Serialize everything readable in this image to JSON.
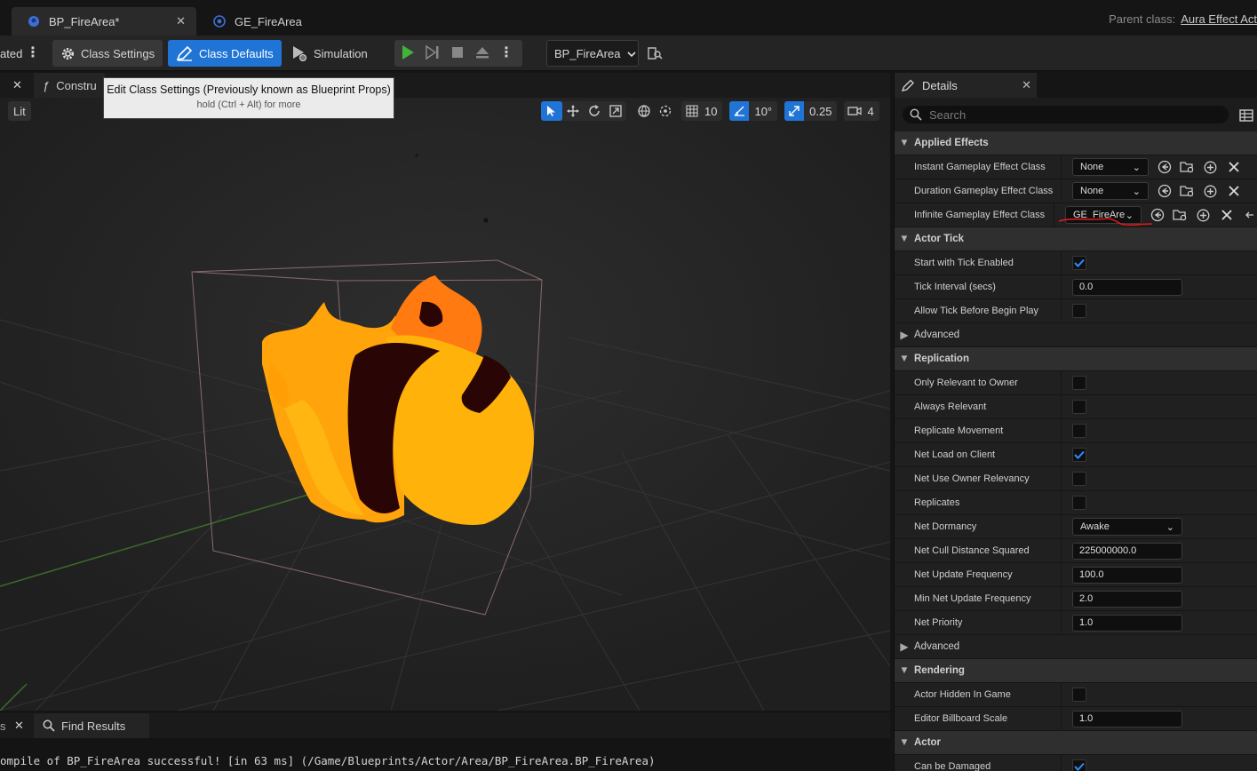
{
  "tabs": [
    {
      "label": "BP_FireArea*"
    },
    {
      "label": "GE_FireArea"
    }
  ],
  "parent_class": {
    "prefix": "Parent class:",
    "value": "Aura Effect Act"
  },
  "toolbar": {
    "left_cut_label": "ated",
    "class_settings": "Class Settings",
    "class_defaults": "Class Defaults",
    "simulation": "Simulation",
    "debug_object": "BP_FireArea"
  },
  "tooltip": {
    "title": "Edit Class Settings (Previously known as Blueprint Props)",
    "hint": "hold (Ctrl + Alt) for more"
  },
  "viewport": {
    "construction_tab": "Constru",
    "view_mode": "Lit",
    "grid_snap": "10",
    "rotation_snap": "10°",
    "scale_snap": "0.25",
    "camera_speed": "4"
  },
  "bottom": {
    "find_results": "Find Results",
    "log_line": "ompile of BP_FireArea successful! [in 63 ms] (/Game/Blueprints/Actor/Area/BP_FireArea.BP_FireArea)"
  },
  "details": {
    "title": "Details",
    "search_placeholder": "Search",
    "applied_effects": {
      "category": "Applied Effects",
      "instant_label": "Instant Gameplay Effect Class",
      "instant_value": "None",
      "duration_label": "Duration Gameplay Effect Class",
      "duration_value": "None",
      "infinite_label": "Infinite Gameplay Effect Class",
      "infinite_value": "GE_FireAre"
    },
    "actor_tick": {
      "category": "Actor Tick",
      "start_label": "Start with Tick Enabled",
      "start_checked": true,
      "interval_label": "Tick Interval (secs)",
      "interval_value": "0.0",
      "allow_label": "Allow Tick Before Begin Play",
      "allow_checked": false,
      "advanced": "Advanced"
    },
    "replication": {
      "category": "Replication",
      "only_relevant": "Only Relevant to Owner",
      "always_relevant": "Always Relevant",
      "replicate_movement": "Replicate Movement",
      "net_load": "Net Load on Client",
      "net_use_owner": "Net Use Owner Relevancy",
      "replicates": "Replicates",
      "dormancy_label": "Net Dormancy",
      "dormancy_value": "Awake",
      "cull_label": "Net Cull Distance Squared",
      "cull_value": "225000000.0",
      "update_label": "Net Update Frequency",
      "update_value": "100.0",
      "min_update_label": "Min Net Update Frequency",
      "min_update_value": "2.0",
      "priority_label": "Net Priority",
      "priority_value": "1.0",
      "advanced": "Advanced"
    },
    "rendering": {
      "category": "Rendering",
      "hidden_label": "Actor Hidden In Game",
      "billboard_label": "Editor Billboard Scale",
      "billboard_value": "1.0"
    },
    "actor": {
      "category": "Actor",
      "can_be_damaged": "Can be Damaged"
    }
  },
  "colors": {
    "accent_blue": "#1f74d6",
    "fire_orange": "#ffa40a",
    "fire_dark": "#2a0505"
  }
}
